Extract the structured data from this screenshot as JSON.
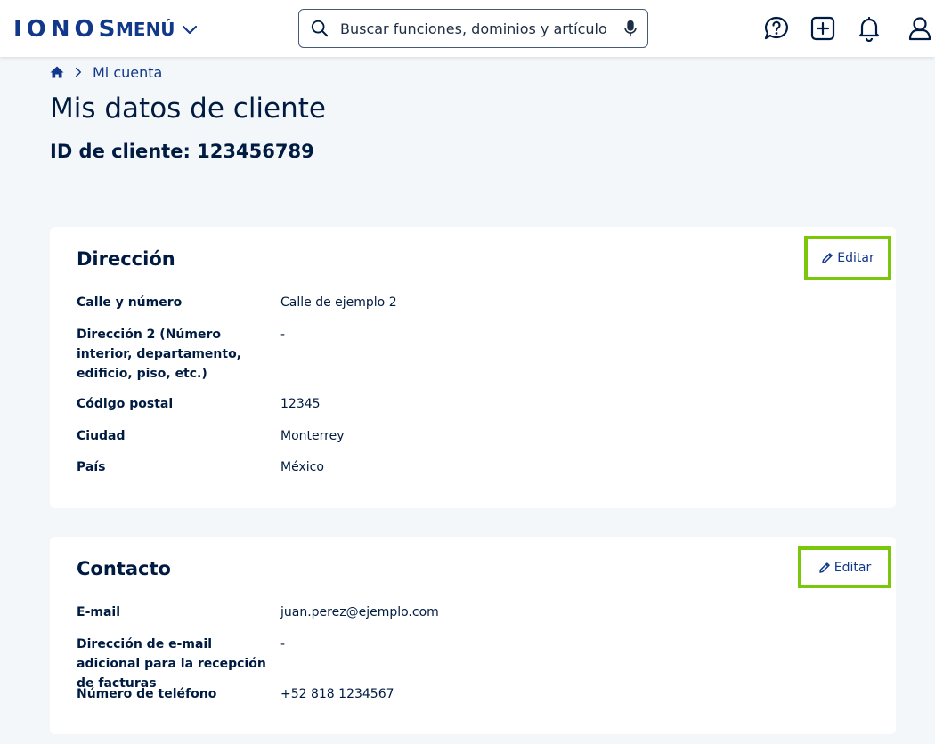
{
  "header": {
    "logo": "IONOS",
    "menu_label": "MENÚ",
    "search_placeholder": "Buscar funciones, dominios y artículos ..."
  },
  "breadcrumb": {
    "current": "Mi cuenta"
  },
  "page": {
    "title": "Mis datos de cliente",
    "customer_id": "ID de cliente: 123456789"
  },
  "address": {
    "heading": "Dirección",
    "edit_label": "Editar",
    "rows": [
      {
        "label": "Calle y número",
        "value": "Calle de ejemplo 2"
      },
      {
        "label": "Dirección 2 (Número interior, departamento, edificio, piso, etc.)",
        "value": "-"
      },
      {
        "label": "Código postal",
        "value": "12345"
      },
      {
        "label": "Ciudad",
        "value": "Monterrey"
      },
      {
        "label": "País",
        "value": "México"
      }
    ]
  },
  "contact": {
    "heading": "Contacto",
    "edit_label": "Editar",
    "rows": [
      {
        "label": "E-mail",
        "value": "juan.perez@ejemplo.com"
      },
      {
        "label": "Dirección de e-mail adicional para la recepción de facturas",
        "value": "-"
      },
      {
        "label": "Número de teléfono",
        "value": "+52 818 1234567"
      }
    ]
  },
  "colors": {
    "brand": "#11388a",
    "text": "#001b41",
    "highlight": "#7ac70c",
    "background": "#f4f7fa"
  },
  "icons": [
    "search-icon",
    "microphone-icon",
    "help-chat-icon",
    "add-icon",
    "bell-icon",
    "user-icon",
    "home-icon",
    "chevron-right-icon",
    "pencil-icon",
    "chevron-down-icon"
  ]
}
